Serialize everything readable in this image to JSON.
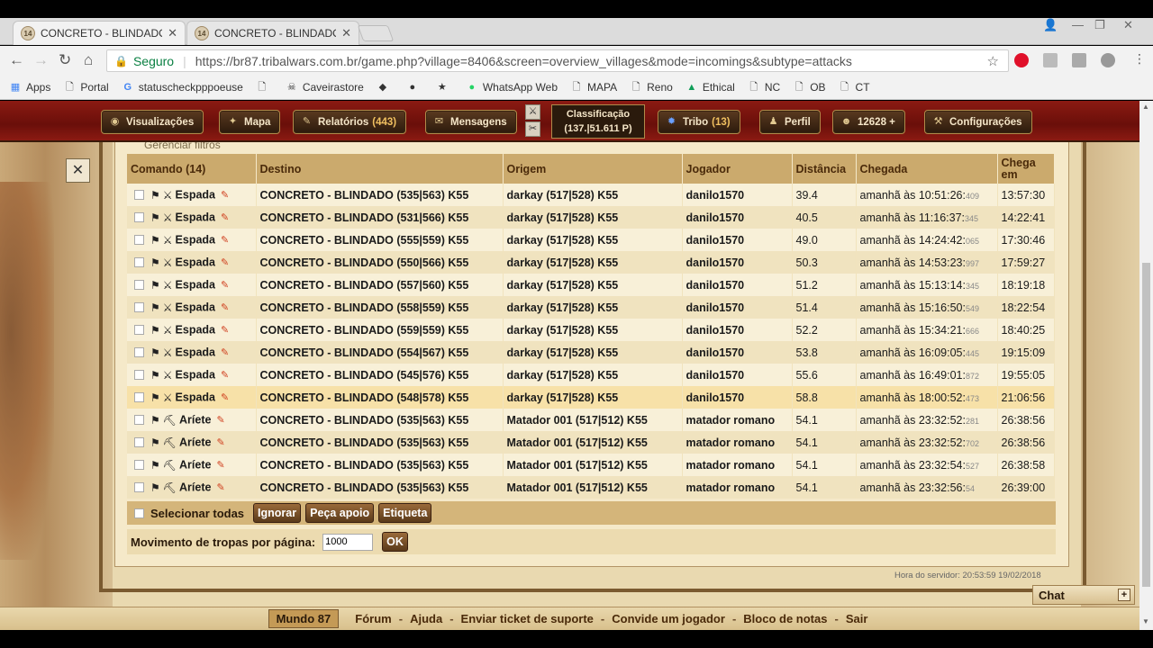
{
  "browser": {
    "tabs": [
      {
        "favicon": "14",
        "title": "CONCRETO - BLINDADO",
        "close": "✕"
      },
      {
        "favicon": "14",
        "title": "CONCRETO - BLINDADO",
        "close": "✕"
      }
    ],
    "secure_label": "Seguro",
    "url": "https://br87.tribalwars.com.br/game.php?village=8406&screen=overview_villages&mode=incomings&subtype=attacks",
    "bookmarks": [
      "Apps",
      "Portal",
      "statuscheckpppoeuse",
      "Caveirastore",
      "WhatsApp Web",
      "MAPA",
      "Reno",
      "Ethical",
      "NC",
      "OB",
      "CT"
    ]
  },
  "menu": {
    "visualizacoes": "Visualizações",
    "mapa": "Mapa",
    "relatorios": "Relatórios",
    "relatorios_count": "(443)",
    "mensagens": "Mensagens",
    "classificacao": "Classificação",
    "classificacao_value": "(137.|51.611 P)",
    "tribo": "Tribo",
    "tribo_count": "(13)",
    "perfil": "Perfil",
    "points": "12628 +",
    "configuracoes": "Configurações"
  },
  "cutoff_text": "Gerenciar filtros",
  "table": {
    "headers": [
      "Comando (14)",
      "Destino",
      "Origem",
      "Jogador",
      "Distância",
      "Chegada",
      "Chega em"
    ],
    "rows": [
      {
        "cmd": "Espada",
        "dest": "CONCRETO - BLINDADO (535|563) K55",
        "orig": "darkay (517|528) K55",
        "player": "danilo1570",
        "dist": "39.4",
        "arrival": "amanhã às 10:51:26:",
        "ms": "409",
        "in": "13:57:30"
      },
      {
        "cmd": "Espada",
        "dest": "CONCRETO - BLINDADO (531|566) K55",
        "orig": "darkay (517|528) K55",
        "player": "danilo1570",
        "dist": "40.5",
        "arrival": "amanhã às 11:16:37:",
        "ms": "345",
        "in": "14:22:41"
      },
      {
        "cmd": "Espada",
        "dest": "CONCRETO - BLINDADO (555|559) K55",
        "orig": "darkay (517|528) K55",
        "player": "danilo1570",
        "dist": "49.0",
        "arrival": "amanhã às 14:24:42:",
        "ms": "065",
        "in": "17:30:46"
      },
      {
        "cmd": "Espada",
        "dest": "CONCRETO - BLINDADO (550|566) K55",
        "orig": "darkay (517|528) K55",
        "player": "danilo1570",
        "dist": "50.3",
        "arrival": "amanhã às 14:53:23:",
        "ms": "997",
        "in": "17:59:27"
      },
      {
        "cmd": "Espada",
        "dest": "CONCRETO - BLINDADO (557|560) K55",
        "orig": "darkay (517|528) K55",
        "player": "danilo1570",
        "dist": "51.2",
        "arrival": "amanhã às 15:13:14:",
        "ms": "345",
        "in": "18:19:18"
      },
      {
        "cmd": "Espada",
        "dest": "CONCRETO - BLINDADO (558|559) K55",
        "orig": "darkay (517|528) K55",
        "player": "danilo1570",
        "dist": "51.4",
        "arrival": "amanhã às 15:16:50:",
        "ms": "549",
        "in": "18:22:54"
      },
      {
        "cmd": "Espada",
        "dest": "CONCRETO - BLINDADO (559|559) K55",
        "orig": "darkay (517|528) K55",
        "player": "danilo1570",
        "dist": "52.2",
        "arrival": "amanhã às 15:34:21:",
        "ms": "666",
        "in": "18:40:25"
      },
      {
        "cmd": "Espada",
        "dest": "CONCRETO - BLINDADO (554|567) K55",
        "orig": "darkay (517|528) K55",
        "player": "danilo1570",
        "dist": "53.8",
        "arrival": "amanhã às 16:09:05:",
        "ms": "445",
        "in": "19:15:09"
      },
      {
        "cmd": "Espada",
        "dest": "CONCRETO - BLINDADO (545|576) K55",
        "orig": "darkay (517|528) K55",
        "player": "danilo1570",
        "dist": "55.6",
        "arrival": "amanhã às 16:49:01:",
        "ms": "872",
        "in": "19:55:05"
      },
      {
        "cmd": "Espada",
        "dest": "CONCRETO - BLINDADO (548|578) K55",
        "orig": "darkay (517|528) K55",
        "player": "danilo1570",
        "dist": "58.8",
        "arrival": "amanhã às 18:00:52:",
        "ms": "473",
        "in": "21:06:56"
      },
      {
        "cmd": "Aríete",
        "dest": "CONCRETO - BLINDADO (535|563) K55",
        "orig": "Matador 001 (517|512) K55",
        "player": "matador romano",
        "dist": "54.1",
        "arrival": "amanhã às 23:32:52:",
        "ms": "281",
        "in": "26:38:56"
      },
      {
        "cmd": "Aríete",
        "dest": "CONCRETO - BLINDADO (535|563) K55",
        "orig": "Matador 001 (517|512) K55",
        "player": "matador romano",
        "dist": "54.1",
        "arrival": "amanhã às 23:32:52:",
        "ms": "702",
        "in": "26:38:56"
      },
      {
        "cmd": "Aríete",
        "dest": "CONCRETO - BLINDADO (535|563) K55",
        "orig": "Matador 001 (517|512) K55",
        "player": "matador romano",
        "dist": "54.1",
        "arrival": "amanhã às 23:32:54:",
        "ms": "527",
        "in": "26:38:58"
      },
      {
        "cmd": "Aríete",
        "dest": "CONCRETO - BLINDADO (535|563) K55",
        "orig": "Matador 001 (517|512) K55",
        "player": "matador romano",
        "dist": "54.1",
        "arrival": "amanhã às 23:32:56:",
        "ms": "54",
        "in": "26:39:00"
      }
    ]
  },
  "actions": {
    "select_all": "Selecionar todas",
    "ignore": "Ignorar",
    "support": "Peça apoio",
    "label": "Etiqueta"
  },
  "perpage": {
    "label": "Movimento de tropas por página:",
    "value": "1000",
    "ok": "OK"
  },
  "server_time": "Hora do servidor: 20:53:59 19/02/2018",
  "chat": "Chat",
  "footer": {
    "world": "Mundo 87",
    "links": [
      "Fórum",
      "Ajuda",
      "Enviar ticket de suporte",
      "Convide um jogador",
      "Bloco de notas",
      "Sair"
    ]
  }
}
